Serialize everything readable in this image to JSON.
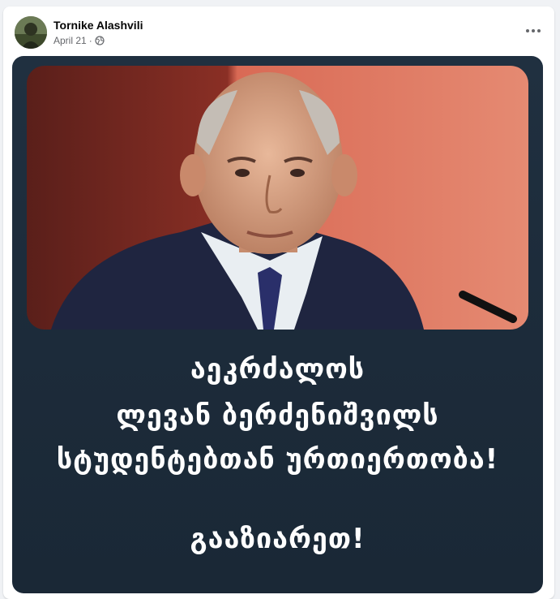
{
  "post": {
    "author": "Tornike Alashvili",
    "date": "April 21",
    "separator": "·",
    "privacy_icon": "globe-icon",
    "menu_icon": "more-options-icon"
  },
  "image": {
    "line1": "აეკრძალოს",
    "line2": "ლევან ბერძენიშვილს",
    "line3": "სტუდენტებთან ურთიერთობა!",
    "line4": "გააზიარეთ!"
  },
  "colors": {
    "card_bg": "#ffffff",
    "page_bg": "#f0f2f5",
    "image_bg": "#1d2c3b",
    "text_primary": "#050505",
    "text_secondary": "#65676b"
  }
}
